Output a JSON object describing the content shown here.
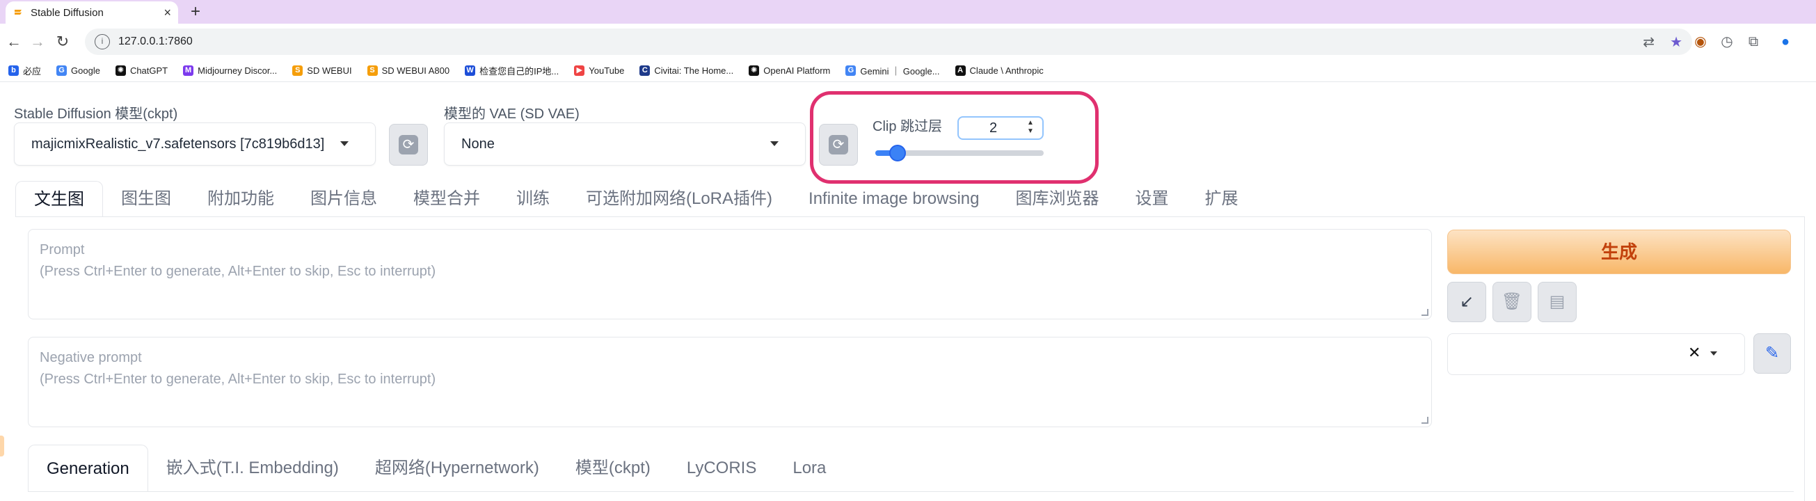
{
  "browser": {
    "tab_title": "Stable Diffusion",
    "tab_close": "×",
    "new_tab": "+",
    "url": "127.0.0.1:7860",
    "bookmarks": [
      {
        "label": "必应",
        "icon": "bing-icon",
        "color": "#2563eb",
        "glyph": "b"
      },
      {
        "label": "Google",
        "icon": "google-icon",
        "color": "#4285f4",
        "glyph": "G"
      },
      {
        "label": "ChatGPT",
        "icon": "chatgpt-icon",
        "color": "#111111",
        "glyph": "✺"
      },
      {
        "label": "Midjourney Discor...",
        "icon": "midjourney-icon",
        "color": "#7c3aed",
        "glyph": "M"
      },
      {
        "label": "SD WEBUI",
        "icon": "sd-webui-icon",
        "color": "#f59e0b",
        "glyph": "S"
      },
      {
        "label": "SD WEBUI A800",
        "icon": "sd-webui-a800-icon",
        "color": "#f59e0b",
        "glyph": "S"
      },
      {
        "label": "检查您自己的IP地...",
        "icon": "ip-check-icon",
        "color": "#1d4ed8",
        "glyph": "W"
      },
      {
        "label": "YouTube",
        "icon": "youtube-icon",
        "color": "#ef4444",
        "glyph": "▶"
      },
      {
        "label": "Civitai: The Home...",
        "icon": "civitai-icon",
        "color": "#1e3a8a",
        "glyph": "C"
      },
      {
        "label": "OpenAI Platform",
        "icon": "openai-icon",
        "color": "#111111",
        "glyph": "✺"
      },
      {
        "label": "Gemini ｜ Google...",
        "icon": "gemini-icon",
        "color": "#4285f4",
        "glyph": "G"
      },
      {
        "label": "Claude \\ Anthropic",
        "icon": "anthropic-icon",
        "color": "#111111",
        "glyph": "A"
      }
    ]
  },
  "top": {
    "ckpt_label": "Stable Diffusion 模型(ckpt)",
    "ckpt_value": "majicmixRealistic_v7.safetensors [7c819b6d13]",
    "vae_label": "模型的 VAE (SD VAE)",
    "vae_value": "None",
    "clip_label": "Clip 跳过层",
    "clip_value": "2",
    "clip_slider_fraction": 0.083
  },
  "tabs": [
    {
      "label": "文生图",
      "active": true
    },
    {
      "label": "图生图",
      "active": false
    },
    {
      "label": "附加功能",
      "active": false
    },
    {
      "label": "图片信息",
      "active": false
    },
    {
      "label": "模型合并",
      "active": false
    },
    {
      "label": "训练",
      "active": false
    },
    {
      "label": "可选附加网络(LoRA插件)",
      "active": false
    },
    {
      "label": "Infinite image browsing",
      "active": false
    },
    {
      "label": "图库浏览器",
      "active": false
    },
    {
      "label": "设置",
      "active": false
    },
    {
      "label": "扩展",
      "active": false
    }
  ],
  "prompt": {
    "title": "Prompt",
    "hint": "(Press Ctrl+Enter to generate, Alt+Enter to skip, Esc to interrupt)"
  },
  "negative_prompt": {
    "title": "Negative prompt",
    "hint": "(Press Ctrl+Enter to generate, Alt+Enter to skip, Esc to interrupt)"
  },
  "generate_label": "生成",
  "style_clear": "✕",
  "subtabs": [
    {
      "label": "Generation",
      "active": true
    },
    {
      "label": "嵌入式(T.I. Embedding)",
      "active": false
    },
    {
      "label": "超网络(Hypernetwork)",
      "active": false
    },
    {
      "label": "模型(ckpt)",
      "active": false
    },
    {
      "label": "LyCORIS",
      "active": false
    },
    {
      "label": "Lora",
      "active": false
    }
  ],
  "colors": {
    "highlight_ring": "#e0306f",
    "generate_text": "#c2410c",
    "slider": "#3b82f6",
    "tabstrip": "#e9d5f6"
  }
}
